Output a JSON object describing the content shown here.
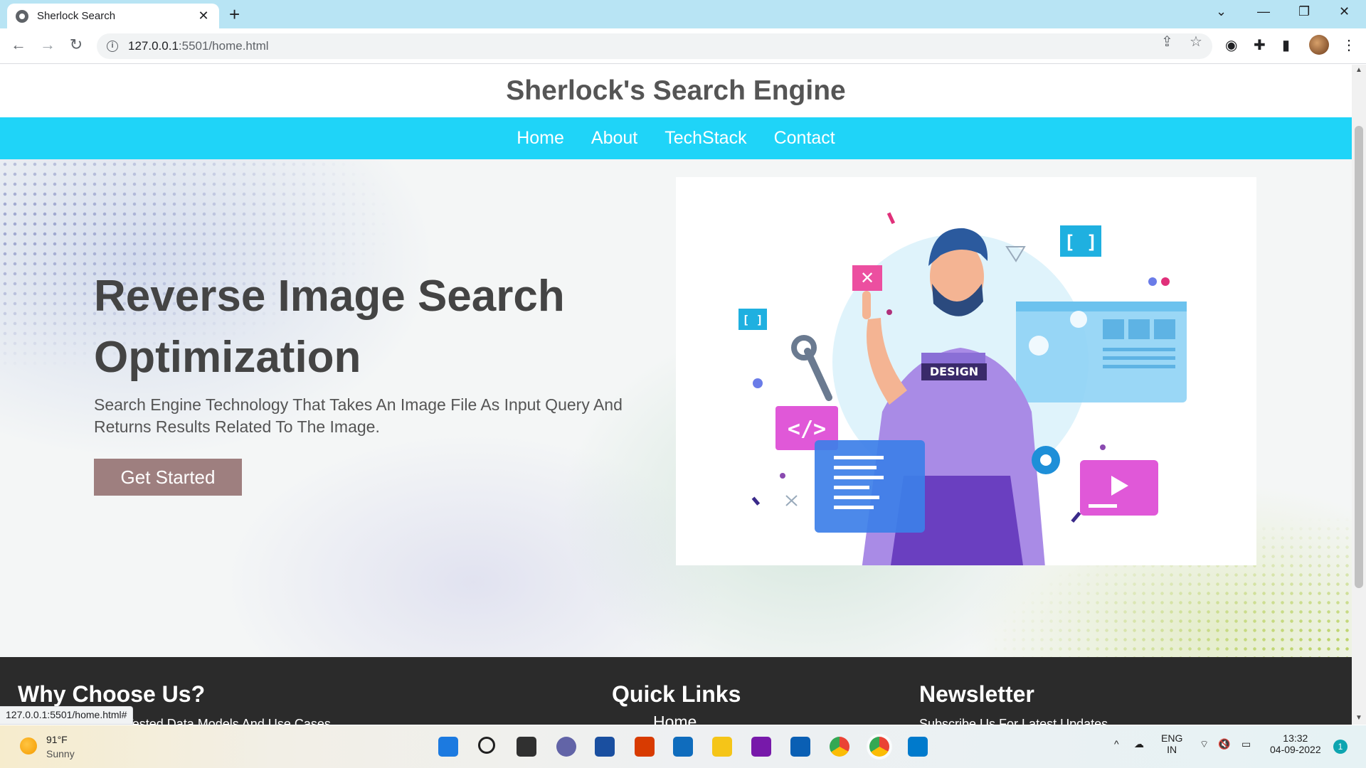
{
  "browser": {
    "tab_title": "Sherlock Search",
    "tab_close": "✕",
    "new_tab": "+",
    "url_host": "127.0.0.1",
    "url_rest": ":5501/home.html",
    "status_url": "127.0.0.1:5501/home.html#"
  },
  "site": {
    "title": "Sherlock's Search Engine",
    "nav": [
      "Home",
      "About",
      "TechStack",
      "Contact"
    ],
    "hero": {
      "heading_line1": "Reverse Image Search",
      "heading_line2": "Optimization",
      "subtitle": "Search Engine Technology That Takes An Image File As Input Query And Returns Results Related To The Image.",
      "cta": "Get Started"
    },
    "illustration": {
      "badge_text": "DESIGN"
    },
    "footer": {
      "why_title": "Why Choose Us?",
      "why_text": "...ed & Tested Data Models And Use Cases",
      "links_title": "Quick Links",
      "link_home": "Home",
      "newsletter_title": "Newsletter",
      "newsletter_text": "Subscribe Us For Latest Updates"
    }
  },
  "taskbar": {
    "temp": "91°F",
    "weather": "Sunny",
    "lang_top": "ENG",
    "lang_bottom": "IN",
    "time": "13:32",
    "date": "04-09-2022",
    "notifications": "1"
  },
  "colors": {
    "nav_bg": "#1fd4f8",
    "cta_bg": "#9e7f7f",
    "footer_bg": "#2b2b2b"
  }
}
